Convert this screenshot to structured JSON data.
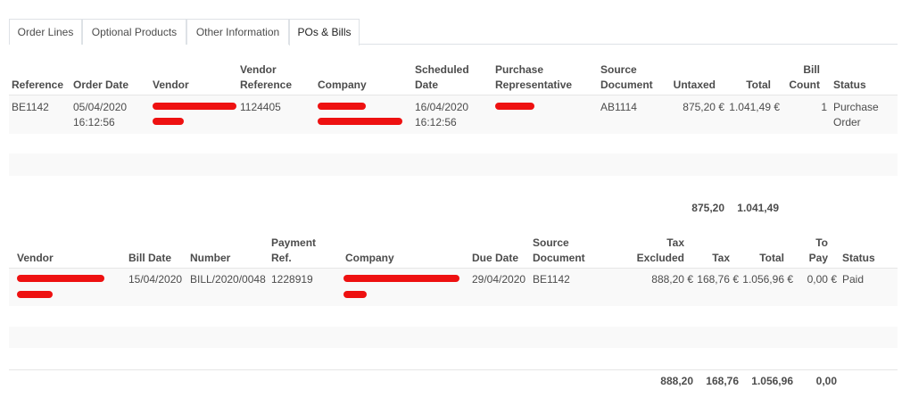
{
  "tabs": [
    "Order Lines",
    "Optional Products",
    "Other Information",
    "POs & Bills"
  ],
  "po": {
    "headers": {
      "reference": "Reference",
      "order_date": "Order Date",
      "vendor": "Vendor",
      "vendor_ref_1": "Vendor",
      "vendor_ref_2": "Reference",
      "company": "Company",
      "sched_1": "Scheduled",
      "sched_2": "Date",
      "purch_1": "Purchase",
      "purch_2": "Representative",
      "src_1": "Source",
      "src_2": "Document",
      "untaxed": "Untaxed",
      "total": "Total",
      "bill_1": "Bill",
      "bill_2": "Count",
      "status": "Status"
    },
    "row": {
      "reference": "BE1142",
      "order_date_1": "05/04/2020",
      "order_date_2": "16:12:56",
      "vendor_ref": "1124405",
      "sched_1": "16/04/2020",
      "sched_2": "16:12:56",
      "source": "AB1114",
      "untaxed": "875,20 €",
      "total": "1.041,49 €",
      "bill_count": "1",
      "status_1": "Purchase",
      "status_2": "Order"
    },
    "totals": {
      "untaxed": "875,20",
      "total": "1.041,49"
    }
  },
  "bills": {
    "headers": {
      "vendor": "Vendor",
      "bill_date": "Bill Date",
      "number": "Number",
      "pay_1": "Payment",
      "pay_2": "Ref.",
      "company": "Company",
      "due": "Due Date",
      "src_1": "Source",
      "src_2": "Document",
      "taxex_1": "Tax",
      "taxex_2": "Excluded",
      "tax": "Tax",
      "total": "Total",
      "topay_1": "To",
      "topay_2": "Pay",
      "status": "Status"
    },
    "row": {
      "bill_date": "15/04/2020",
      "number": "BILL/2020/0048",
      "payment_ref": "1228919",
      "due": "29/04/2020",
      "source": "BE1142",
      "tax_excluded": "888,20 €",
      "tax": "168,76 €",
      "total": "1.056,96 €",
      "to_pay": "0,00 €",
      "status": "Paid"
    },
    "totals": {
      "tax_excluded": "888,20",
      "tax": "168,76",
      "total": "1.056,96",
      "to_pay": "0,00"
    }
  },
  "colors": {
    "redaction": "#ee1111",
    "stripe": "#f9f9f9",
    "border": "#dee2e6"
  }
}
